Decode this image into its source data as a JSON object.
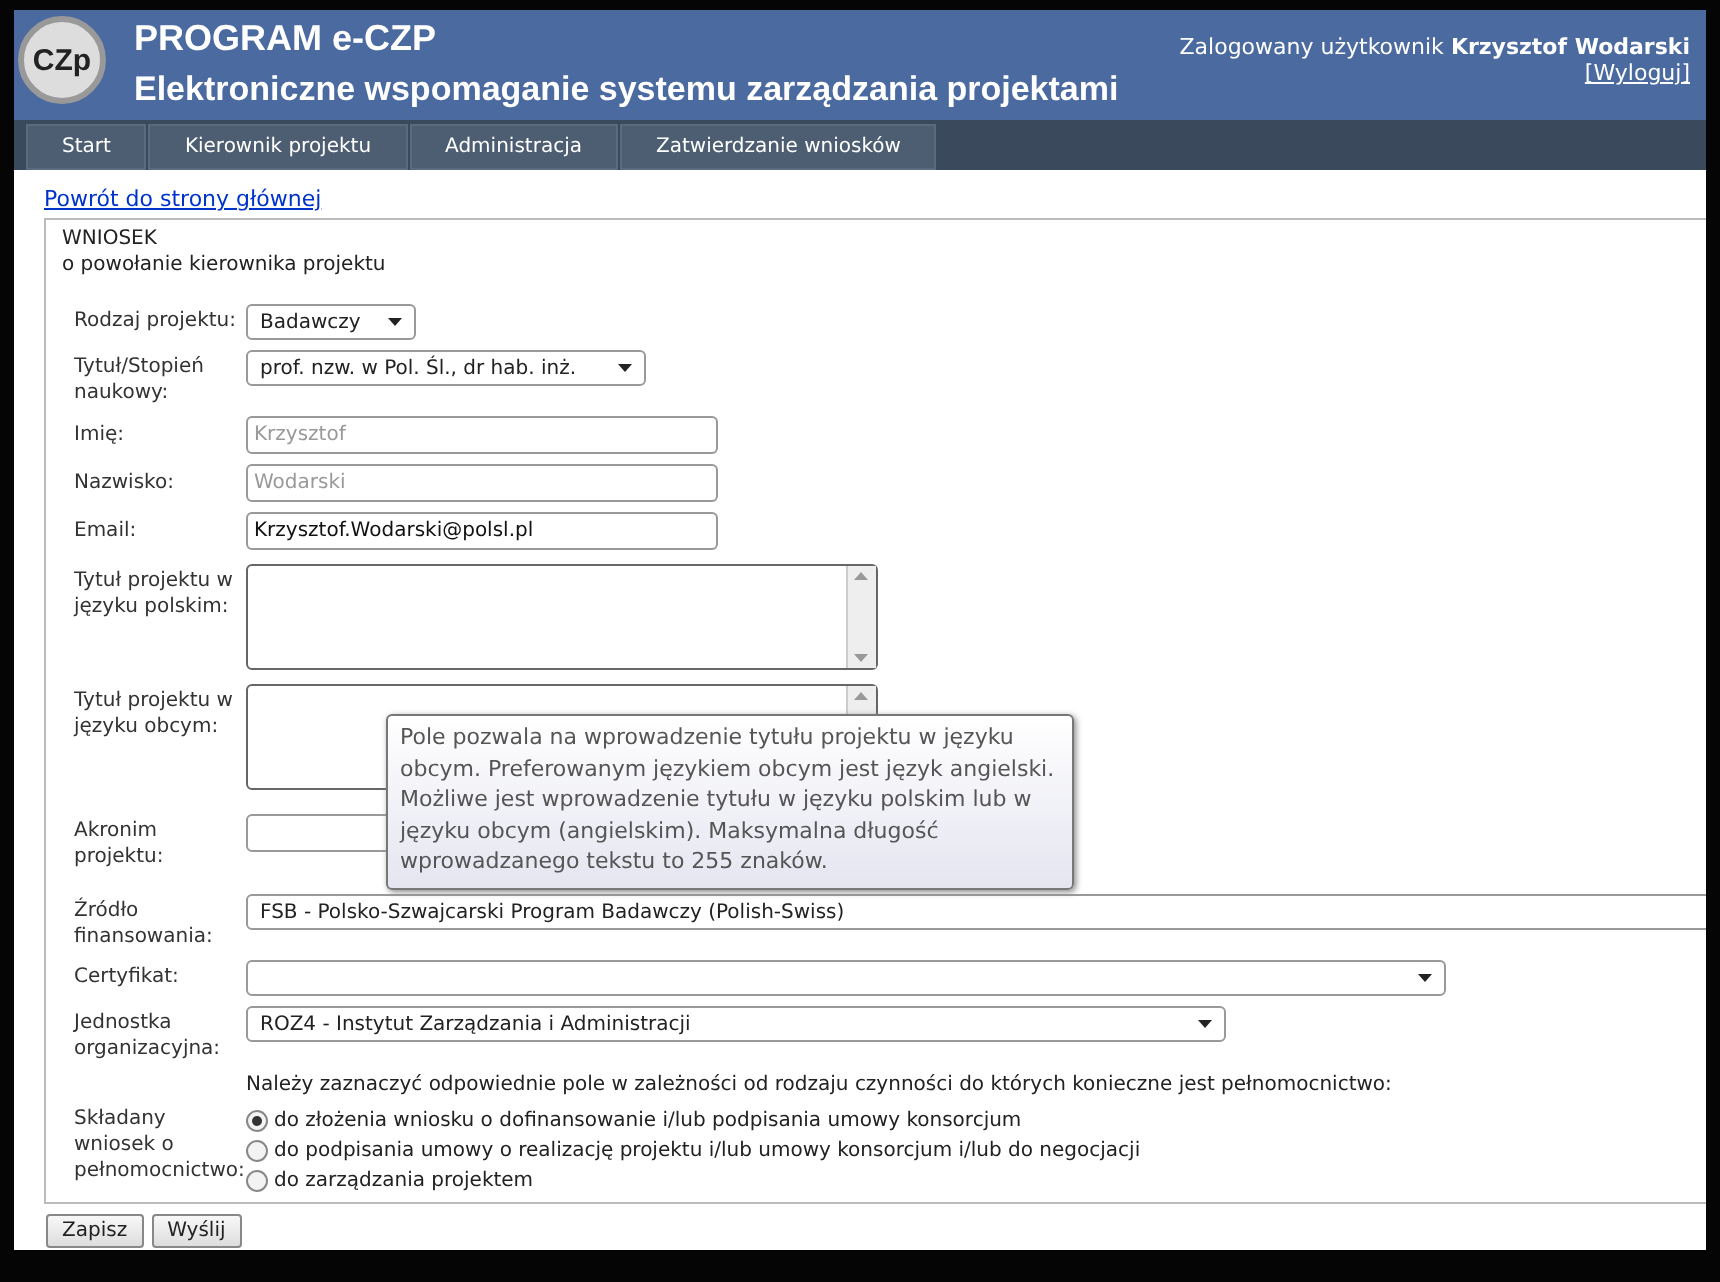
{
  "header": {
    "logo_text": "CZp",
    "title": "PROGRAM e-CZP",
    "subtitle": "Elektroniczne wspomaganie systemu zarządzania projektami",
    "user_label": "Zalogowany użytkownik",
    "user_name": "Krzysztof Wodarski",
    "logout": "[Wyloguj]"
  },
  "nav": [
    {
      "label": "Start"
    },
    {
      "label": "Kierownik projektu"
    },
    {
      "label": "Administracja"
    },
    {
      "label": "Zatwierdzanie wniosków"
    }
  ],
  "back_link": "Powrót do strony głównej",
  "form": {
    "title": "WNIOSEK",
    "subtitle": "o powołanie kierownika projektu",
    "fields": [
      {
        "kind": "select",
        "label": "Rodzaj projektu:",
        "value": "Badawczy"
      },
      {
        "kind": "select",
        "label": "Tytuł/Stopień naukowy:",
        "value": "prof. nzw. w Pol. Śl., dr hab. inż."
      },
      {
        "kind": "text",
        "label": "Imię:",
        "value": "Krzysztof",
        "disabled": true
      },
      {
        "kind": "text",
        "label": "Nazwisko:",
        "value": "Wodarski",
        "disabled": true
      },
      {
        "kind": "text",
        "label": "Email:",
        "value": "Krzysztof.Wodarski@polsl.pl",
        "disabled": false
      },
      {
        "kind": "textarea",
        "label": "Tytuł projektu w języku polskim:"
      },
      {
        "kind": "textarea",
        "label": "Tytuł projektu w języku obcym:"
      },
      {
        "kind": "text",
        "label": "Akronim projektu:"
      },
      {
        "kind": "select",
        "label": "Źródło finansowania:",
        "value": "FSB - Polsko-Szwajcarski Program Badawczy (Polish-Swiss)"
      },
      {
        "kind": "select",
        "label": "Certyfikat:"
      },
      {
        "kind": "select",
        "label": "Jednostka organizacyjna:",
        "value": "ROZ4 - Instytut Zarządzania i Administracji"
      }
    ],
    "note": "Należy zaznaczyć odpowiednie pole w zależności od rodzaju czynności do których konieczne jest pełnomocnictwo:",
    "radio_label": "Składany wniosek o pełnomocnictwo:",
    "radio_options": [
      {
        "label": "do złożenia wniosku o dofinansowanie i/lub podpisania umowy konsorcjum",
        "selected": true
      },
      {
        "label": "do podpisania umowy o realizację projektu i/lub umowy konsorcjum i/lub do negocjacji",
        "selected": false
      },
      {
        "label": "do zarządzania projektem",
        "selected": false
      }
    ]
  },
  "tooltip": "Pole pozwala na wprowadzenie tytułu projektu w języku obcym. Preferowanym językiem obcym jest język angielski. Możliwe jest wprowadzenie tytułu w języku polskim lub w języku obcym (angielskim). Maksymalna długość wprowadzanego tekstu to 255 znaków.",
  "buttons": [
    {
      "label": "Zapisz"
    },
    {
      "label": "Wyślij"
    }
  ]
}
